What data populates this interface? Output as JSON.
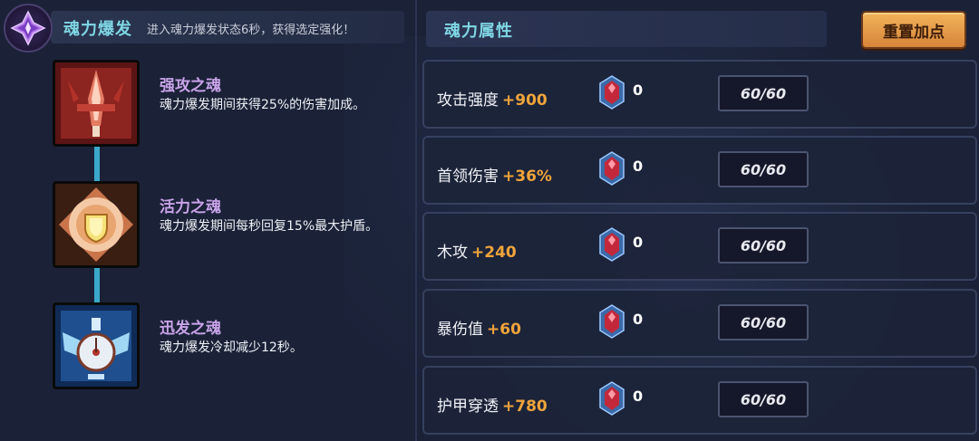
{
  "burst": {
    "title": "魂力爆发",
    "description": "进入魂力爆发状态6秒，获得选定强化！",
    "emblem_icon": "purple-crystal-emblem-icon"
  },
  "souls": [
    {
      "name": "强攻之魂",
      "description": "魂力爆发期间获得25%的伤害加成。",
      "icon": "red-sword-icon"
    },
    {
      "name": "活力之魂",
      "description": "魂力爆发期间每秒回复15%最大护盾。",
      "icon": "golden-shield-icon"
    },
    {
      "name": "迅发之魂",
      "description": "魂力爆发冷却减少12秒。",
      "icon": "winged-clock-icon"
    }
  ],
  "attributes": {
    "title": "魂力属性",
    "reset_label": "重置加点",
    "rows": [
      {
        "name": "攻击强度",
        "bonus": "+900",
        "gems": "0",
        "cap": "60/60"
      },
      {
        "name": "首领伤害",
        "bonus": "+36%",
        "gems": "0",
        "cap": "60/60"
      },
      {
        "name": "木攻",
        "bonus": "+240",
        "gems": "0",
        "cap": "60/60"
      },
      {
        "name": "暴伤值",
        "bonus": "+60",
        "gems": "0",
        "cap": "60/60"
      },
      {
        "name": "护甲穿透",
        "bonus": "+780",
        "gems": "0",
        "cap": "60/60"
      }
    ]
  },
  "colors": {
    "accent_cyan": "#7fd6e4",
    "soul_name_purple": "#c8a3e8",
    "bonus_orange": "#f0a43b",
    "button_orange": "#e29a47"
  }
}
